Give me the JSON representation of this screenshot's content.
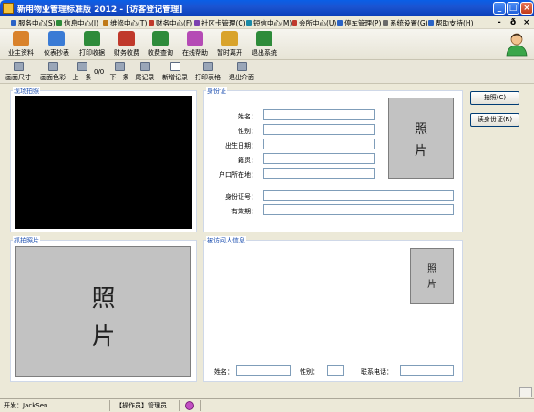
{
  "window": {
    "title": "新用物业管理标准版 2012 - [访客登记管理]",
    "controls": {
      "minimize": "_",
      "maximize": "□",
      "close": "×"
    }
  },
  "menu": {
    "items": [
      {
        "label": "服务中心(S)",
        "color": "#2a63c6"
      },
      {
        "label": "信息中心(I)",
        "color": "#2e8b3a"
      },
      {
        "label": "维修中心(T)",
        "color": "#c07a16"
      },
      {
        "label": "财务中心(F)",
        "color": "#c0392b"
      },
      {
        "label": "社区卡管理(C)",
        "color": "#7b3fb0"
      },
      {
        "label": "短信中心(M)",
        "color": "#1a8aa8"
      },
      {
        "label": "会所中心(U)",
        "color": "#c0392b"
      },
      {
        "label": "停车管理(P)",
        "color": "#2a63c6"
      },
      {
        "label": "系统设置(G)",
        "color": "#6b6b6b"
      },
      {
        "label": "帮助支持(H)",
        "color": "#2a63c6"
      }
    ],
    "mdi": {
      "minimize": "-",
      "restore": "ð",
      "close": "×"
    }
  },
  "toolbar": {
    "buttons": [
      {
        "label": "业主资料",
        "icon": "owners-icon",
        "color": "#d9822b"
      },
      {
        "label": "仪表抄表",
        "icon": "meter-icon",
        "color": "#3a7bd5"
      },
      {
        "label": "打印收据",
        "icon": "print-receipt-icon",
        "color": "#2e8b3a"
      },
      {
        "label": "财务收费",
        "icon": "finance-icon",
        "color": "#c0392b"
      },
      {
        "label": "收费查询",
        "icon": "fee-query-icon",
        "color": "#2e8b3a"
      },
      {
        "label": "在线帮助",
        "icon": "help-icon",
        "color": "#b54bb5"
      },
      {
        "label": "暂时离开",
        "icon": "lock-icon",
        "color": "#d9a32b"
      },
      {
        "label": "退出系统",
        "icon": "exit-icon",
        "color": "#2e8b3a"
      }
    ]
  },
  "subtoolbar": {
    "buttons": [
      {
        "label": "画面尺寸",
        "icon": "screen-size-icon"
      },
      {
        "label": "画面色彩",
        "icon": "screen-color-icon"
      },
      {
        "label": "上一条",
        "icon": "prev-record-icon"
      },
      {
        "label": "下一条",
        "icon": "next-record-icon"
      },
      {
        "label": "尾记录",
        "icon": "last-record-icon"
      },
      {
        "label": "新增记录",
        "icon": "new-record-icon"
      },
      {
        "label": "打印表格",
        "icon": "print-table-icon"
      },
      {
        "label": "退出介面",
        "icon": "exit-screen-icon"
      }
    ],
    "counter": "0/0"
  },
  "live_panel": {
    "title": "现场拍照"
  },
  "capture_panel": {
    "title": "抓拍照片",
    "photo_line1": "照",
    "photo_line2": "片"
  },
  "id_card": {
    "title": "身份证",
    "fields": {
      "name": "姓名：",
      "gender": "性别：",
      "birthdate": "出生日期：",
      "origin": "籍贯：",
      "household": "户口所在地：",
      "id_number": "身份证号：",
      "validity": "有效期："
    },
    "photo_line1": "照",
    "photo_line2": "片"
  },
  "visitee": {
    "title": "被访问人信息",
    "photo_line1": "照",
    "photo_line2": "片",
    "name_label": "姓名：",
    "gender_label": "性别：",
    "phone_label": "联系电话："
  },
  "actions": {
    "capture": "拍照(C)",
    "read_id": "读身份证(R)"
  },
  "status": {
    "developer": "开发：JackSen",
    "operator": "【操作员】管理员"
  }
}
